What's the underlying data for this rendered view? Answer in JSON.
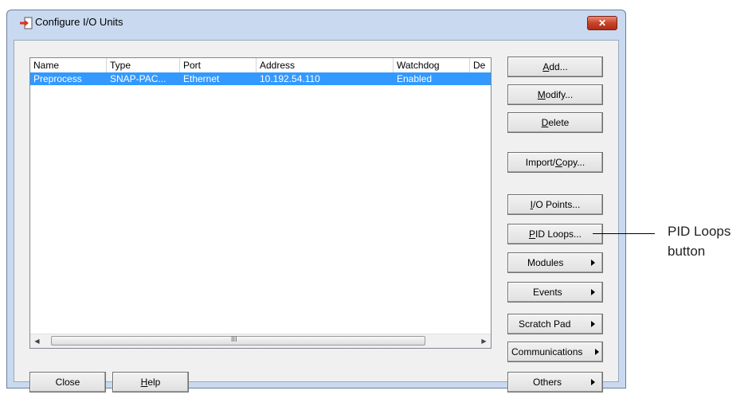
{
  "window": {
    "title": "Configure I/O Units",
    "close_glyph": "✕"
  },
  "list": {
    "columns": [
      "Name",
      "Type",
      "Port",
      "Address",
      "Watchdog",
      "De"
    ],
    "rows": [
      {
        "name": "Preprocess",
        "type": "SNAP-PAC...",
        "port": "Ethernet",
        "address": "10.192.54.110",
        "watchdog": "Enabled"
      }
    ],
    "scroll_left": "◀",
    "scroll_right": "▶",
    "scroll_grip": "III"
  },
  "buttons": {
    "add": {
      "pre": "",
      "ul": "A",
      "post": "dd..."
    },
    "modify": {
      "pre": "",
      "ul": "M",
      "post": "odify..."
    },
    "delete": {
      "pre": "",
      "ul": "D",
      "post": "elete"
    },
    "import": {
      "pre": "Import/",
      "ul": "C",
      "post": "opy..."
    },
    "io_points": {
      "pre": "",
      "ul": "I",
      "post": "/O Points..."
    },
    "pid_loops": {
      "pre": "",
      "ul": "P",
      "post": "ID Loops..."
    },
    "modules": "Modules",
    "events": "Events",
    "scratch_pad": "Scratch Pad",
    "communications": "Communications",
    "others": "Others",
    "close": "Close",
    "help": {
      "pre": "",
      "ul": "H",
      "post": "elp"
    }
  },
  "callout": {
    "line1": "PID Loops",
    "line2": "button"
  },
  "colors": {
    "selection": "#3399ff",
    "window_frame": "#c9daf0",
    "client_bg": "#f0f0f0"
  }
}
